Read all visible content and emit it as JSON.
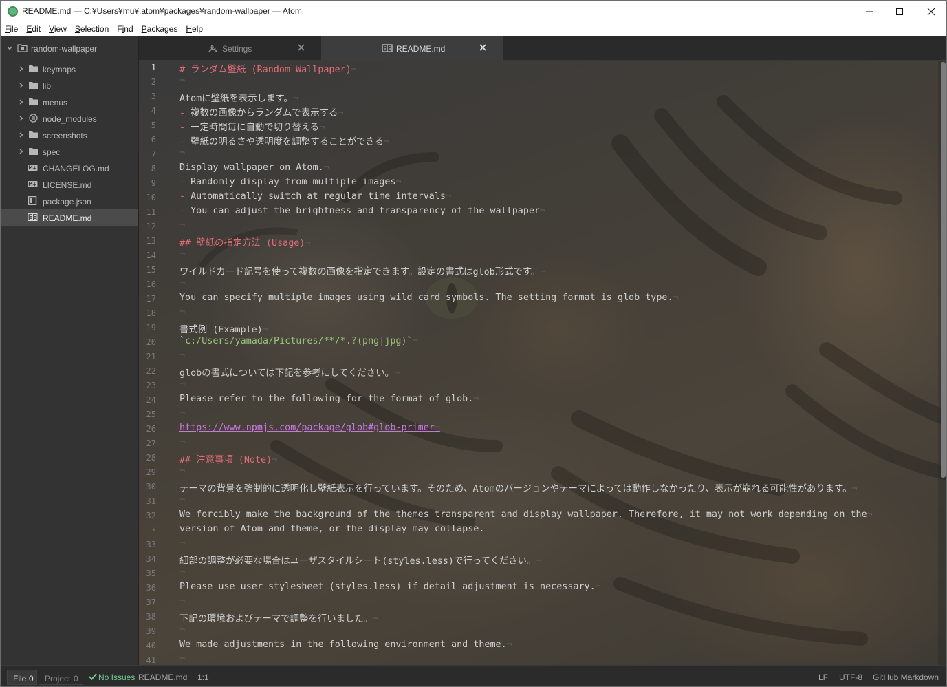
{
  "window": {
    "title": "README.md — C:¥Users¥mu¥.atom¥packages¥random-wallpaper — Atom",
    "controls": [
      "minimize",
      "maximize",
      "close"
    ]
  },
  "menubar": {
    "items": [
      {
        "label": "File",
        "accel": "F"
      },
      {
        "label": "Edit",
        "accel": "E"
      },
      {
        "label": "View",
        "accel": "V"
      },
      {
        "label": "Selection",
        "accel": "S"
      },
      {
        "label": "Find",
        "accel": "i"
      },
      {
        "label": "Packages",
        "accel": "P"
      },
      {
        "label": "Help",
        "accel": "H"
      }
    ]
  },
  "tree": {
    "root": "random-wallpaper",
    "items": [
      {
        "label": "keymaps",
        "type": "folder"
      },
      {
        "label": "lib",
        "type": "folder"
      },
      {
        "label": "menus",
        "type": "folder"
      },
      {
        "label": "node_modules",
        "type": "linked-folder"
      },
      {
        "label": "screenshots",
        "type": "folder"
      },
      {
        "label": "spec",
        "type": "folder"
      },
      {
        "label": "CHANGELOG.md",
        "type": "markdown"
      },
      {
        "label": "LICENSE.md",
        "type": "markdown"
      },
      {
        "label": "package.json",
        "type": "json"
      },
      {
        "label": "README.md",
        "type": "book",
        "selected": true
      }
    ]
  },
  "tabs": [
    {
      "label": "Settings",
      "icon": "tools-icon",
      "active": false
    },
    {
      "label": "README.md",
      "icon": "book-icon",
      "active": true
    }
  ],
  "editor": {
    "cursor_line": "1",
    "lines": [
      {
        "n": "1",
        "t": "# ランダム壁紙 (Random Wallpaper)",
        "k": "heading"
      },
      {
        "n": "2",
        "t": "",
        "k": "blank"
      },
      {
        "n": "3",
        "t": "Atomに壁紙を表示します。",
        "k": "text"
      },
      {
        "n": "4",
        "t": "複数の画像からランダムで表示する",
        "k": "list"
      },
      {
        "n": "5",
        "t": "一定時間毎に自動で切り替える",
        "k": "list"
      },
      {
        "n": "6",
        "t": "壁紙の明るさや透明度を調整することができる",
        "k": "list"
      },
      {
        "n": "7",
        "t": "",
        "k": "blank"
      },
      {
        "n": "8",
        "t": "Display wallpaper on Atom.",
        "k": "text"
      },
      {
        "n": "9",
        "t": "Randomly display from multiple images",
        "k": "list"
      },
      {
        "n": "10",
        "t": "Automatically switch at regular time intervals",
        "k": "list"
      },
      {
        "n": "11",
        "t": "You can adjust the brightness and transparency of the wallpaper",
        "k": "list"
      },
      {
        "n": "12",
        "t": "",
        "k": "blank"
      },
      {
        "n": "13",
        "t": "## 壁紙の指定方法 (Usage)",
        "k": "heading"
      },
      {
        "n": "14",
        "t": "",
        "k": "blank"
      },
      {
        "n": "15",
        "t": "ワイルドカード記号を使って複数の画像を指定できます。設定の書式はglob形式です。",
        "k": "text"
      },
      {
        "n": "16",
        "t": "",
        "k": "blank"
      },
      {
        "n": "17",
        "t": "You can specify multiple images using wild card symbols. The setting format is glob type.",
        "k": "text"
      },
      {
        "n": "18",
        "t": "",
        "k": "blank"
      },
      {
        "n": "19",
        "t": "書式例 (Example)",
        "k": "text"
      },
      {
        "n": "20",
        "t": "c:/Users/yamada/Pictures/**/*.?(png|jpg)",
        "k": "inline"
      },
      {
        "n": "21",
        "t": "",
        "k": "blank"
      },
      {
        "n": "22",
        "t": "globの書式については下記を参考にしてください。",
        "k": "text"
      },
      {
        "n": "23",
        "t": "",
        "k": "blank"
      },
      {
        "n": "24",
        "t": "Please refer to the following for the format of glob.",
        "k": "text"
      },
      {
        "n": "25",
        "t": "",
        "k": "blank"
      },
      {
        "n": "26",
        "t": "https://www.npmjs.com/package/glob#glob-primer",
        "k": "link"
      },
      {
        "n": "27",
        "t": "",
        "k": "blank"
      },
      {
        "n": "28",
        "t": "## 注意事項 (Note)",
        "k": "heading"
      },
      {
        "n": "29",
        "t": "",
        "k": "blank"
      },
      {
        "n": "30",
        "t": "テーマの背景を強制的に透明化し壁紙表示を行っています。そのため、Atomのバージョンやテーマによっては動作しなかったり、表示が崩れる可能性があります。",
        "k": "text"
      },
      {
        "n": "31",
        "t": "",
        "k": "blank"
      },
      {
        "n": "32",
        "t": "We forcibly make the background of the themes transparent and display wallpaper. Therefore, it may not work depending on the",
        "k": "text"
      },
      {
        "n": "•",
        "t": "version of Atom and theme, or the display may collapse.",
        "k": "wrap"
      },
      {
        "n": "33",
        "t": "",
        "k": "blank"
      },
      {
        "n": "34",
        "t": "細部の調整が必要な場合はユーザスタイルシート(styles.less)で行ってください。",
        "k": "text"
      },
      {
        "n": "35",
        "t": "",
        "k": "blank"
      },
      {
        "n": "36",
        "t": "Please use user stylesheet (styles.less) if detail adjustment is necessary.",
        "k": "text"
      },
      {
        "n": "37",
        "t": "",
        "k": "blank"
      },
      {
        "n": "38",
        "t": "下記の環境およびテーマで調整を行いました。",
        "k": "text"
      },
      {
        "n": "39",
        "t": "",
        "k": "blank"
      },
      {
        "n": "40",
        "t": "We made adjustments in the following environment and theme.",
        "k": "text"
      },
      {
        "n": "41",
        "t": "",
        "k": "blank"
      }
    ]
  },
  "statusbar": {
    "file_label": "File",
    "file_count": "0",
    "project_label": "Project",
    "project_count": "0",
    "issues": "No Issues",
    "filename": "README.md",
    "cursor": "1:1",
    "line_ending": "LF",
    "encoding": "UTF-8",
    "grammar": "GitHub Markdown"
  },
  "colors": {
    "heading": "#e06c75",
    "inline_code": "#98c379",
    "link": "#c678dd",
    "ok": "#73c990"
  }
}
